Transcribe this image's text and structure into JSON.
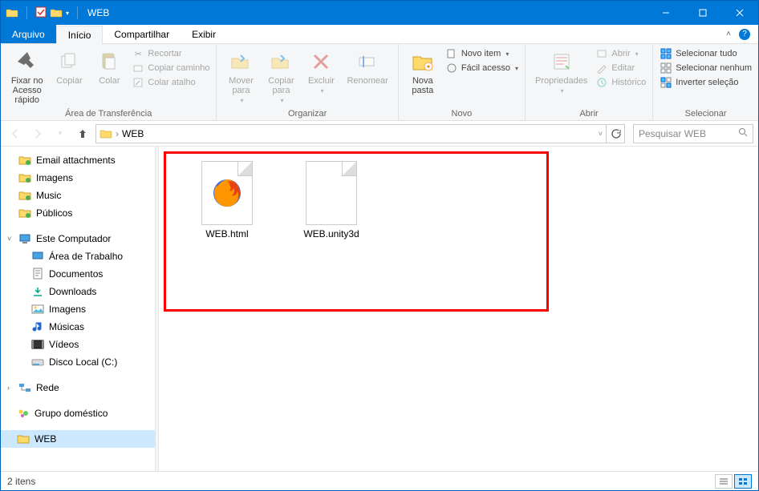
{
  "window": {
    "title": "WEB"
  },
  "tabs": {
    "file": "Arquivo",
    "home": "Início",
    "share": "Compartilhar",
    "view": "Exibir"
  },
  "ribbon": {
    "clipboard": {
      "pin": "Fixar no\nAcesso rápido",
      "copy": "Copiar",
      "paste": "Colar",
      "cut": "Recortar",
      "copy_path": "Copiar caminho",
      "paste_shortcut": "Colar atalho",
      "label": "Área de Transferência"
    },
    "organize": {
      "move_to": "Mover\npara",
      "copy_to": "Copiar\npara",
      "delete": "Excluir",
      "rename": "Renomear",
      "label": "Organizar"
    },
    "new": {
      "new_folder": "Nova\npasta",
      "new_item": "Novo item",
      "easy_access": "Fácil acesso",
      "label": "Novo"
    },
    "open": {
      "properties": "Propriedades",
      "open": "Abrir",
      "edit": "Editar",
      "history": "Histórico",
      "label": "Abrir"
    },
    "select": {
      "select_all": "Selecionar tudo",
      "select_none": "Selecionar nenhum",
      "invert": "Inverter seleção",
      "label": "Selecionar"
    }
  },
  "address": {
    "path": "WEB",
    "search_placeholder": "Pesquisar WEB"
  },
  "navpane": {
    "quick": {
      "email": "Email attachments",
      "images": "Imagens",
      "music": "Music",
      "public": "Públicos"
    },
    "computer": {
      "label": "Este Computador",
      "desktop": "Área de Trabalho",
      "documents": "Documentos",
      "downloads": "Downloads",
      "images": "Imagens",
      "music": "Músicas",
      "videos": "Vídeos",
      "disk": "Disco Local (C:)"
    },
    "network": "Rede",
    "homegroup": "Grupo doméstico",
    "web": "WEB"
  },
  "files": [
    {
      "name": "WEB.html"
    },
    {
      "name": "WEB.unity3d"
    }
  ],
  "statusbar": {
    "count": "2 itens"
  }
}
